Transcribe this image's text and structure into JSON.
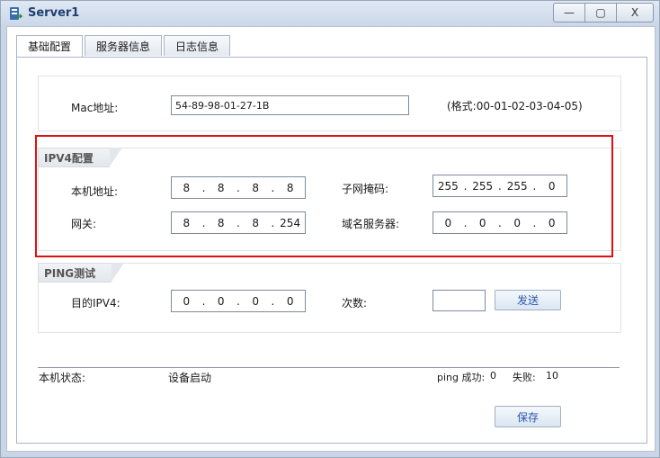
{
  "window": {
    "title": "Server1",
    "min_label": "—",
    "max_label": "▢",
    "close_label": "X"
  },
  "tabs": [
    {
      "label": "基础配置"
    },
    {
      "label": "服务器信息"
    },
    {
      "label": "日志信息"
    }
  ],
  "mac": {
    "label": "Mac地址:",
    "value": "54-89-98-01-27-1B",
    "format_hint": "(格式:00-01-02-03-04-05)"
  },
  "ipv4": {
    "legend": "IPV4配置",
    "local_ip_label": "本机地址:",
    "local_ip": [
      "8",
      "8",
      "8",
      "8"
    ],
    "subnet_label": "子网掩码:",
    "subnet": [
      "255",
      "255",
      "255",
      "0"
    ],
    "gateway_label": "网关:",
    "gateway": [
      "8",
      "8",
      "8",
      "254"
    ],
    "dns_label": "域名服务器:",
    "dns": [
      "0",
      "0",
      "0",
      "0"
    ]
  },
  "ping": {
    "legend": "PING测试",
    "dest_label": "目的IPV4:",
    "dest": [
      "0",
      "0",
      "0",
      "0"
    ],
    "count_label": "次数:",
    "count_value": "",
    "send_label": "发送"
  },
  "status": {
    "label": "本机状态:",
    "value": "设备启动",
    "ping_success_label": "ping 成功:",
    "ping_success": "0",
    "ping_fail_label": "失败:",
    "ping_fail": "10"
  },
  "save_label": "保存",
  "colors": {
    "highlight": "#e01010",
    "title": "#1e3f6e",
    "button_text": "#2a55b0"
  }
}
